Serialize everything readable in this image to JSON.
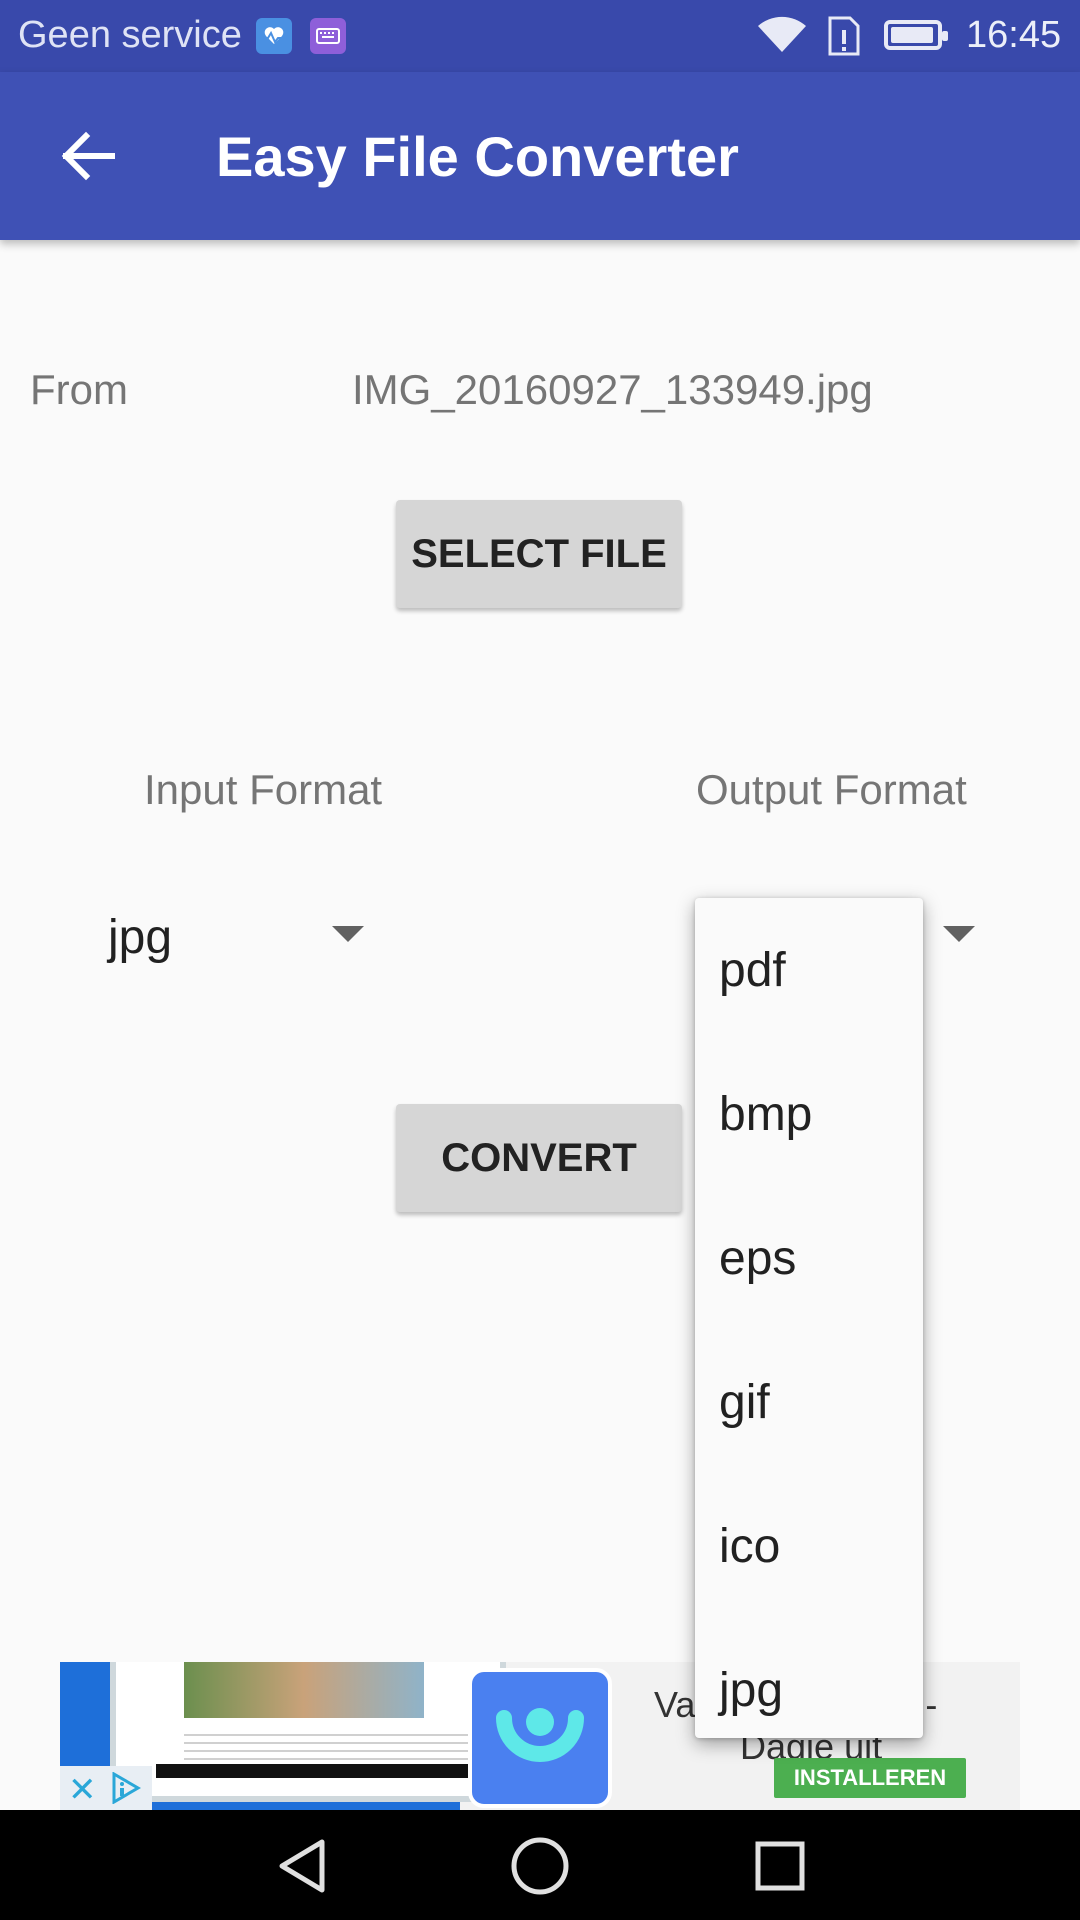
{
  "status_bar": {
    "carrier": "Geen service",
    "time": "16:45",
    "battery_level": 0.95,
    "icons": [
      "health-icon",
      "keyboard-icon",
      "wifi-icon",
      "sim-alert-icon",
      "battery-icon"
    ]
  },
  "app_bar": {
    "title": "Easy File Converter",
    "back_icon": "arrow-left-icon",
    "color": "#3f51b5"
  },
  "main": {
    "from_label": "From",
    "file_name": "IMG_20160927_133949.jpg",
    "select_file_label": "SELECT FILE",
    "input_format_label": "Input Format",
    "output_format_label": "Output Format",
    "input_format_value": "jpg",
    "convert_label": "CONVERT"
  },
  "output_dropdown": {
    "options": [
      "pdf",
      "bmp",
      "eps",
      "gif",
      "ico",
      "jpg"
    ]
  },
  "ad": {
    "text_line1": "Va",
    "text_line1_tail": "en -",
    "text_line2": "Dagje uit",
    "install_label": "INSTALLEREN",
    "close_glyph": "✕"
  },
  "nav_bar": {
    "icons": [
      "back-triangle-icon",
      "home-circle-icon",
      "recents-square-icon"
    ]
  }
}
